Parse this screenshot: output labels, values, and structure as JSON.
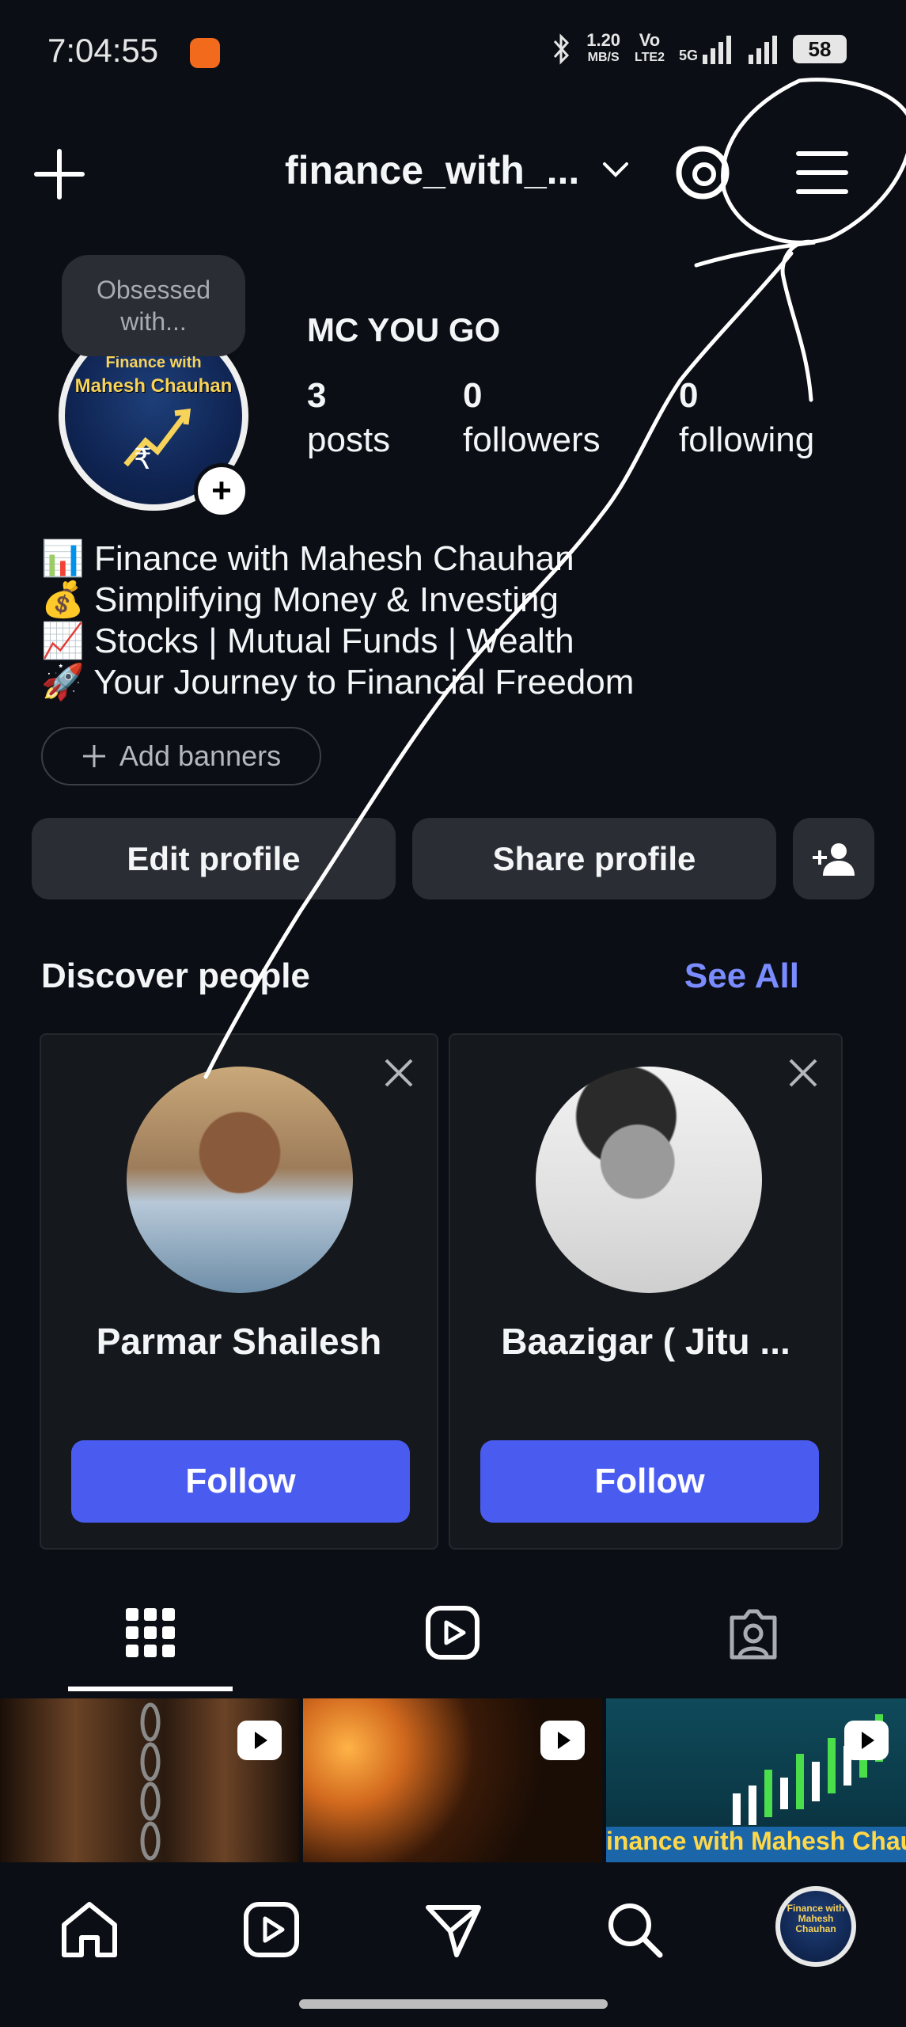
{
  "status_bar": {
    "time": "7:04:55",
    "net_speed": "1.20",
    "net_unit": "MB/S",
    "volte_top": "Vo",
    "volte_bottom": "LTE2",
    "network": "5G",
    "battery": "58"
  },
  "top_bar": {
    "username": "finance_with_..."
  },
  "profile": {
    "note": "Obsessed with...",
    "avatar_text_top": "Finance with",
    "avatar_text": "Mahesh Chauhan",
    "display_name": "MC YOU GO",
    "stats": {
      "posts_count": "3",
      "posts_label": "posts",
      "followers_count": "0",
      "followers_label": "followers",
      "following_count": "0",
      "following_label": "following"
    },
    "bio": [
      "📊 Finance with Mahesh Chauhan",
      "💰 Simplifying Money & Investing",
      "📈 Stocks | Mutual Funds | Wealth",
      "🚀 Your Journey to Financial Freedom"
    ],
    "add_banners_label": "Add banners"
  },
  "actions": {
    "edit_profile": "Edit profile",
    "share_profile": "Share profile"
  },
  "discover": {
    "title": "Discover people",
    "see_all": "See All",
    "cards": [
      {
        "name": "Parmar Shailesh",
        "follow_label": "Follow"
      },
      {
        "name": "Baazigar ( Jitu ...",
        "follow_label": "Follow"
      }
    ]
  },
  "grid": {
    "thumb3_caption": "inance with Mahesh Chauha"
  },
  "nav_avatar_text": "Finance with Mahesh Chauhan",
  "colors": {
    "background": "#0b0e14",
    "button": "#2a2d33",
    "accent": "#4a5cf0",
    "link": "#7a8cff"
  }
}
